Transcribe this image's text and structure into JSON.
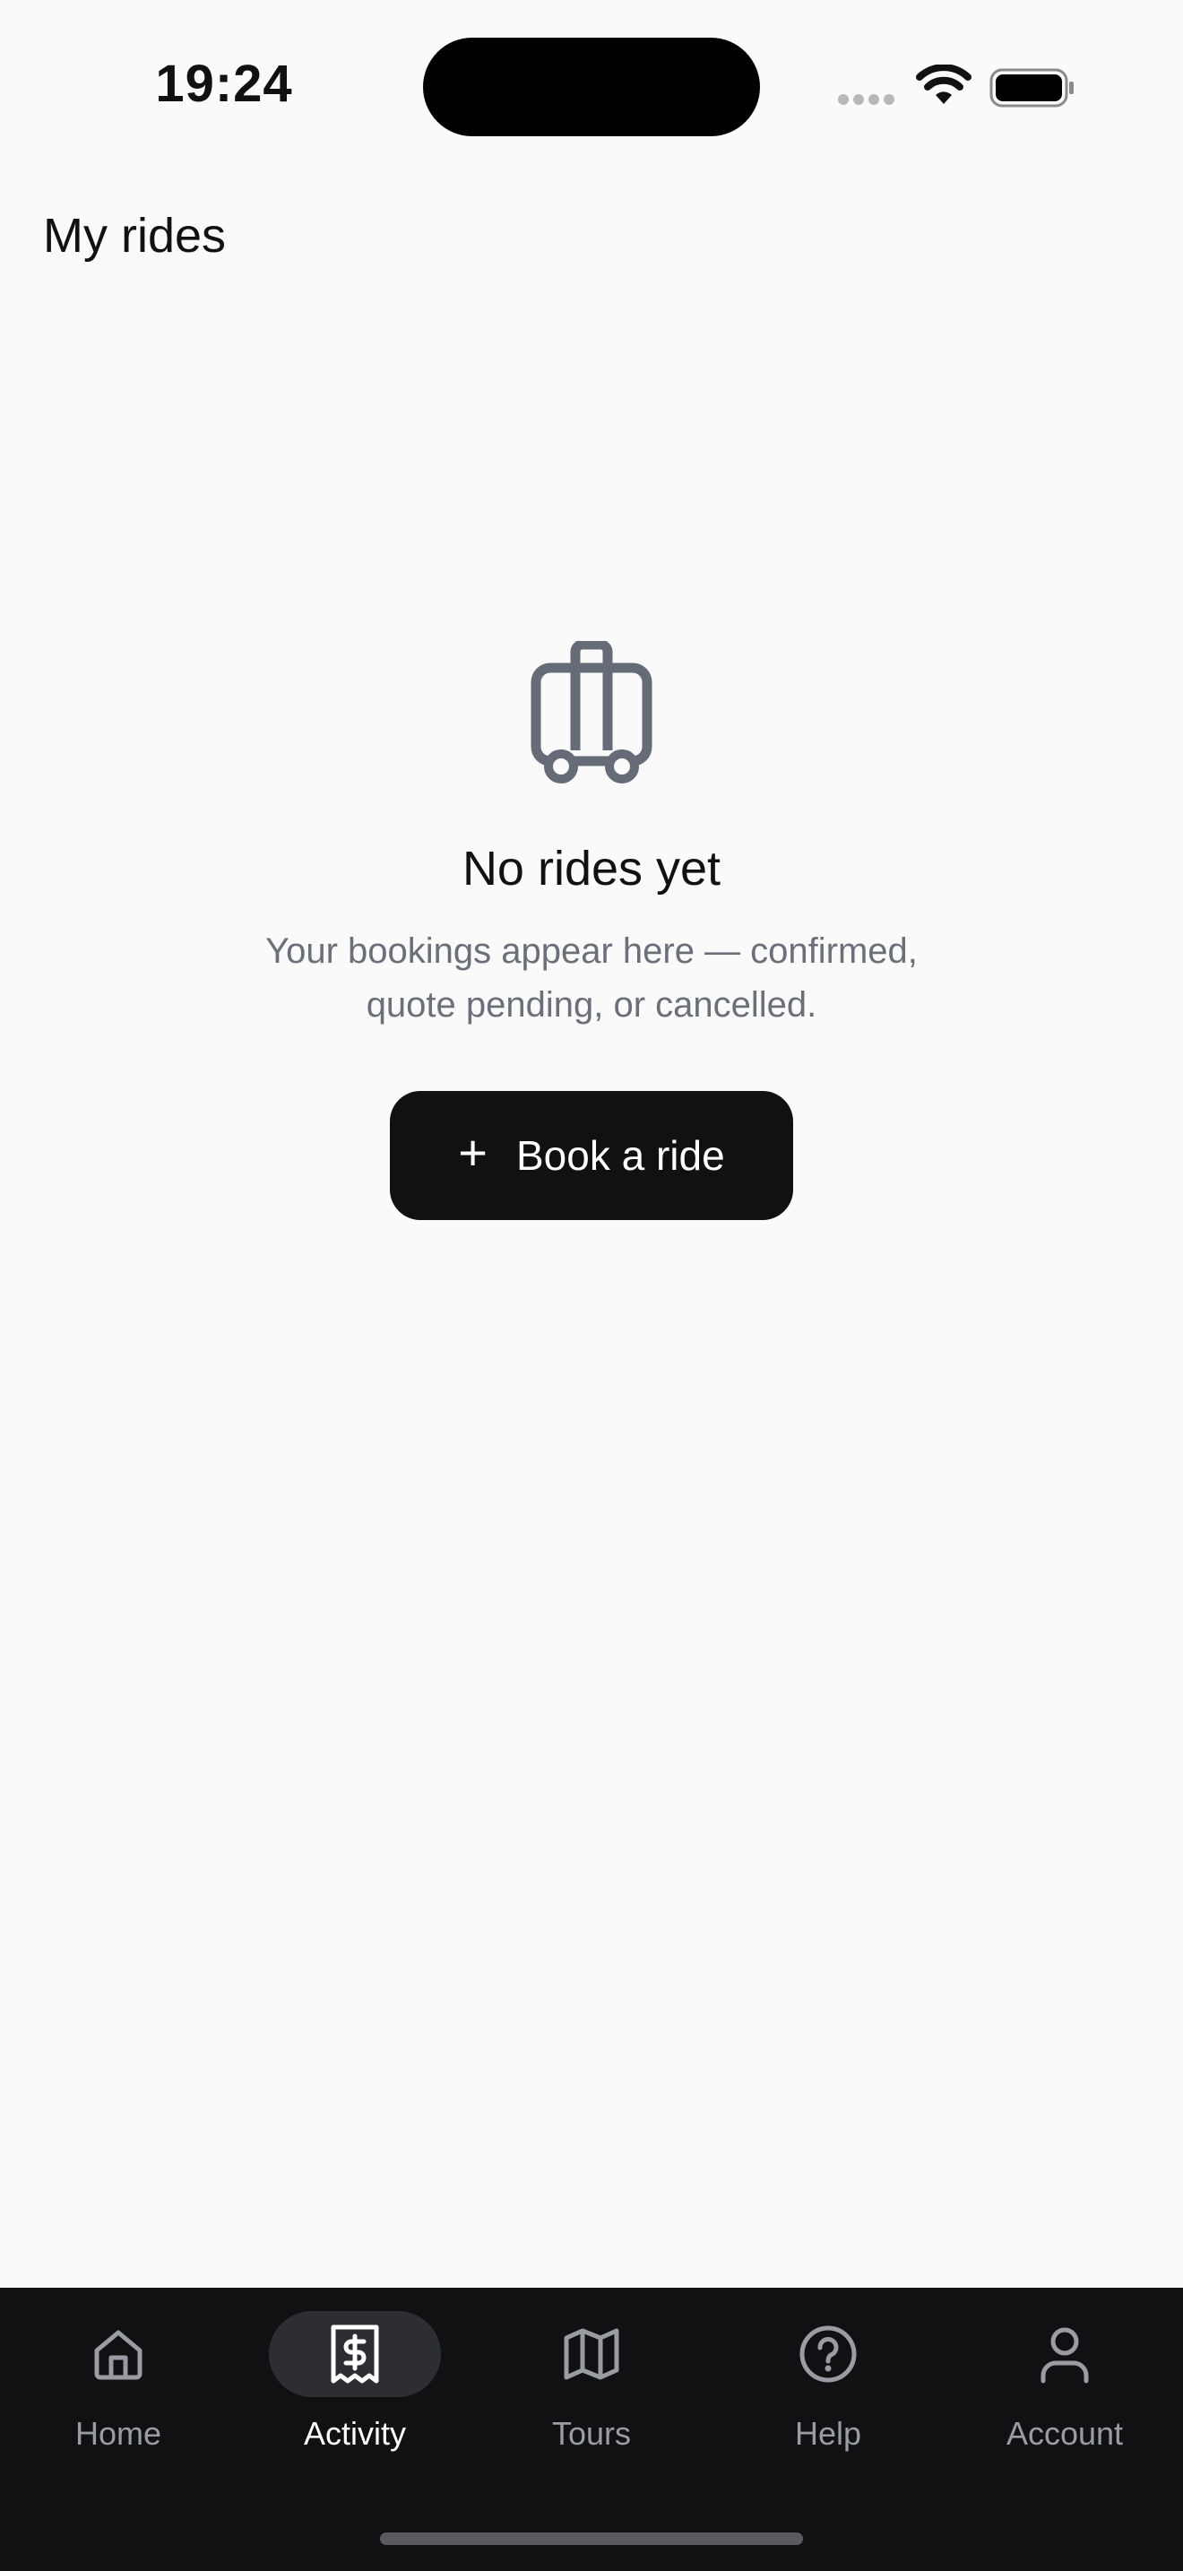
{
  "status_bar": {
    "time": "19:24"
  },
  "header": {
    "title": "My rides"
  },
  "empty_state": {
    "icon": "luggage-icon",
    "title": "No rides yet",
    "description": "Your bookings appear here — confirmed, quote pending, or cancelled.",
    "button_label": "Book a ride",
    "button_icon": "plus-icon"
  },
  "tab_bar": {
    "active": "Activity",
    "items": [
      {
        "label": "Home",
        "icon": "home-icon"
      },
      {
        "label": "Activity",
        "icon": "receipt-icon"
      },
      {
        "label": "Tours",
        "icon": "map-icon"
      },
      {
        "label": "Help",
        "icon": "help-icon"
      },
      {
        "label": "Account",
        "icon": "account-icon"
      }
    ]
  },
  "colors": {
    "background": "#fafafa",
    "primary": "#111113",
    "muted_text": "#6b6f78",
    "icon_gray": "#656b77",
    "tab_inactive": "#9a9ca3",
    "tab_active_bg": "#2d2e31"
  }
}
